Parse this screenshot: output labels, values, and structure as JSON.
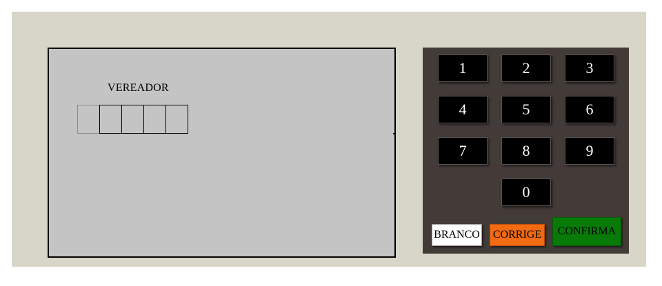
{
  "screen": {
    "office_label": "VEREADOR",
    "digits": [
      "",
      "",
      "",
      "",
      ""
    ]
  },
  "keypad": {
    "keys": [
      "1",
      "2",
      "3",
      "4",
      "5",
      "6",
      "7",
      "8",
      "9",
      "0"
    ]
  },
  "actions": {
    "branco": "BRANCO",
    "corrige": "CORRIGE",
    "confirma": "CONFIRMA"
  },
  "colors": {
    "body": "#d8d5c9",
    "screen": "#c4c4c4",
    "keypad": "#433b38",
    "key": "#000000",
    "branco": "#ffffff",
    "corrige": "#f26a12",
    "confirma": "#087a08"
  }
}
